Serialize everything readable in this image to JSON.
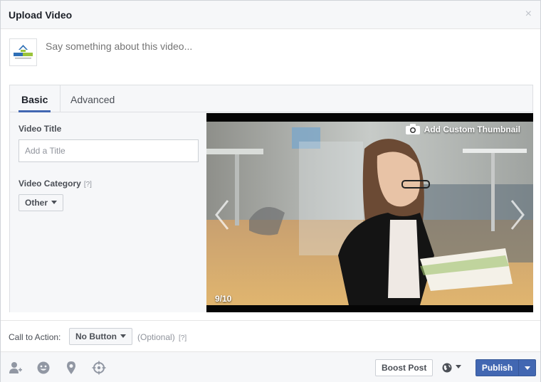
{
  "dialog": {
    "title": "Upload Video",
    "close_glyph": "×"
  },
  "composer": {
    "placeholder": "Say something about this video..."
  },
  "tabs": [
    {
      "label": "Basic",
      "active": true
    },
    {
      "label": "Advanced",
      "active": false
    }
  ],
  "form": {
    "video_title_label": "Video Title",
    "video_title_placeholder": "Add a Title",
    "video_category_label": "Video Category",
    "help_marker": "[?]",
    "category_value": "Other"
  },
  "video": {
    "add_thumbnail_label": "Add Custom Thumbnail",
    "thumbnail_counter": "9/10"
  },
  "call_to_action": {
    "label": "Call to Action:",
    "button_value": "No Button",
    "optional_text": "(Optional)",
    "help_marker": "[?]"
  },
  "footer": {
    "icons": [
      "tag-people-icon",
      "feeling-icon",
      "location-icon",
      "target-icon"
    ],
    "boost_label": "Boost Post",
    "publish_label": "Publish",
    "audience_icon": "globe-icon"
  },
  "colors": {
    "accent": "#4267b2",
    "header_bg": "#f6f7f9",
    "border": "#dddfe2"
  }
}
